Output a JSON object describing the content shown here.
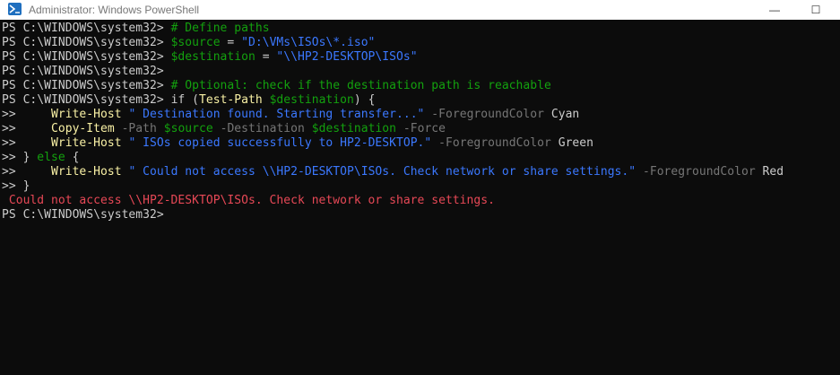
{
  "window": {
    "title": "Administrator: Windows PowerShell",
    "minimize_glyph": "—",
    "maximize_glyph": "☐",
    "icon_name": "powershell-icon",
    "background": "#0c0c0c"
  },
  "colors": {
    "default": "#cccccc",
    "comment": "#13a10e",
    "command": "#f9f1a5",
    "string": "#3b78ff",
    "parameter": "#767676",
    "variable": "#61d6d6",
    "operator": "#ffffff",
    "error": "#e74856"
  },
  "terminal": {
    "prompt": "PS C:\\WINDOWS\\system32> ",
    "continuation": ">> ",
    "lines": [
      [
        {
          "text": "PS C:\\WINDOWS\\system32> ",
          "cls": "w"
        },
        {
          "text": "# Define paths",
          "cls": "g"
        }
      ],
      [
        {
          "text": "PS C:\\WINDOWS\\system32> ",
          "cls": "w"
        },
        {
          "text": "$source",
          "cls": "g"
        },
        {
          "text": " = ",
          "cls": "w"
        },
        {
          "text": "\"D:\\VMs\\ISOs\\*.iso\"",
          "cls": "b"
        }
      ],
      [
        {
          "text": "PS C:\\WINDOWS\\system32> ",
          "cls": "w"
        },
        {
          "text": "$destination",
          "cls": "g"
        },
        {
          "text": " = ",
          "cls": "w"
        },
        {
          "text": "\"\\\\HP2-DESKTOP\\ISOs\"",
          "cls": "b"
        }
      ],
      [
        {
          "text": "PS C:\\WINDOWS\\system32> ",
          "cls": "w"
        }
      ],
      [
        {
          "text": "PS C:\\WINDOWS\\system32> ",
          "cls": "w"
        },
        {
          "text": "# Optional: check if the destination path is reachable",
          "cls": "g"
        }
      ],
      [
        {
          "text": "PS C:\\WINDOWS\\system32> ",
          "cls": "w"
        },
        {
          "text": "if",
          "cls": "w"
        },
        {
          "text": " (",
          "cls": "w"
        },
        {
          "text": "Test-Path",
          "cls": "y"
        },
        {
          "text": " ",
          "cls": "w"
        },
        {
          "text": "$destination",
          "cls": "g"
        },
        {
          "text": ") {",
          "cls": "w"
        }
      ],
      [
        {
          "text": ">>     ",
          "cls": "w"
        },
        {
          "text": "Write-Host",
          "cls": "y"
        },
        {
          "text": " ",
          "cls": "w"
        },
        {
          "text": "\" Destination found. Starting transfer...\"",
          "cls": "b"
        },
        {
          "text": " ",
          "cls": "w"
        },
        {
          "text": "-ForegroundColor",
          "cls": "gr"
        },
        {
          "text": " Cyan",
          "cls": "w"
        }
      ],
      [
        {
          "text": ">>     ",
          "cls": "w"
        },
        {
          "text": "Copy-Item",
          "cls": "y"
        },
        {
          "text": " ",
          "cls": "w"
        },
        {
          "text": "-Path",
          "cls": "gr"
        },
        {
          "text": " ",
          "cls": "w"
        },
        {
          "text": "$source",
          "cls": "g"
        },
        {
          "text": " ",
          "cls": "w"
        },
        {
          "text": "-Destination",
          "cls": "gr"
        },
        {
          "text": " ",
          "cls": "w"
        },
        {
          "text": "$destination",
          "cls": "g"
        },
        {
          "text": " ",
          "cls": "w"
        },
        {
          "text": "-Force",
          "cls": "gr"
        }
      ],
      [
        {
          "text": ">>     ",
          "cls": "w"
        },
        {
          "text": "Write-Host",
          "cls": "y"
        },
        {
          "text": " ",
          "cls": "w"
        },
        {
          "text": "\" ISOs copied successfully to HP2-DESKTOP.\"",
          "cls": "b"
        },
        {
          "text": " ",
          "cls": "w"
        },
        {
          "text": "-ForegroundColor",
          "cls": "gr"
        },
        {
          "text": " Green",
          "cls": "w"
        }
      ],
      [
        {
          "text": ">> ",
          "cls": "w"
        },
        {
          "text": "} ",
          "cls": "w"
        },
        {
          "text": "else",
          "cls": "g"
        },
        {
          "text": " {",
          "cls": "w"
        }
      ],
      [
        {
          "text": ">>     ",
          "cls": "w"
        },
        {
          "text": "Write-Host",
          "cls": "y"
        },
        {
          "text": " ",
          "cls": "w"
        },
        {
          "text": "\" Could not access \\\\HP2-DESKTOP\\ISOs. Check network or share settings.\"",
          "cls": "b"
        },
        {
          "text": " ",
          "cls": "w"
        },
        {
          "text": "-ForegroundColor",
          "cls": "gr"
        },
        {
          "text": " Red",
          "cls": "w"
        }
      ],
      [
        {
          "text": ">> ",
          "cls": "w"
        },
        {
          "text": "}",
          "cls": "w"
        }
      ],
      [
        {
          "text": " Could not access \\\\HP2-DESKTOP\\ISOs. Check network or share settings.",
          "cls": "r"
        }
      ],
      [
        {
          "text": "PS C:\\WINDOWS\\system32> ",
          "cls": "w"
        }
      ]
    ]
  }
}
